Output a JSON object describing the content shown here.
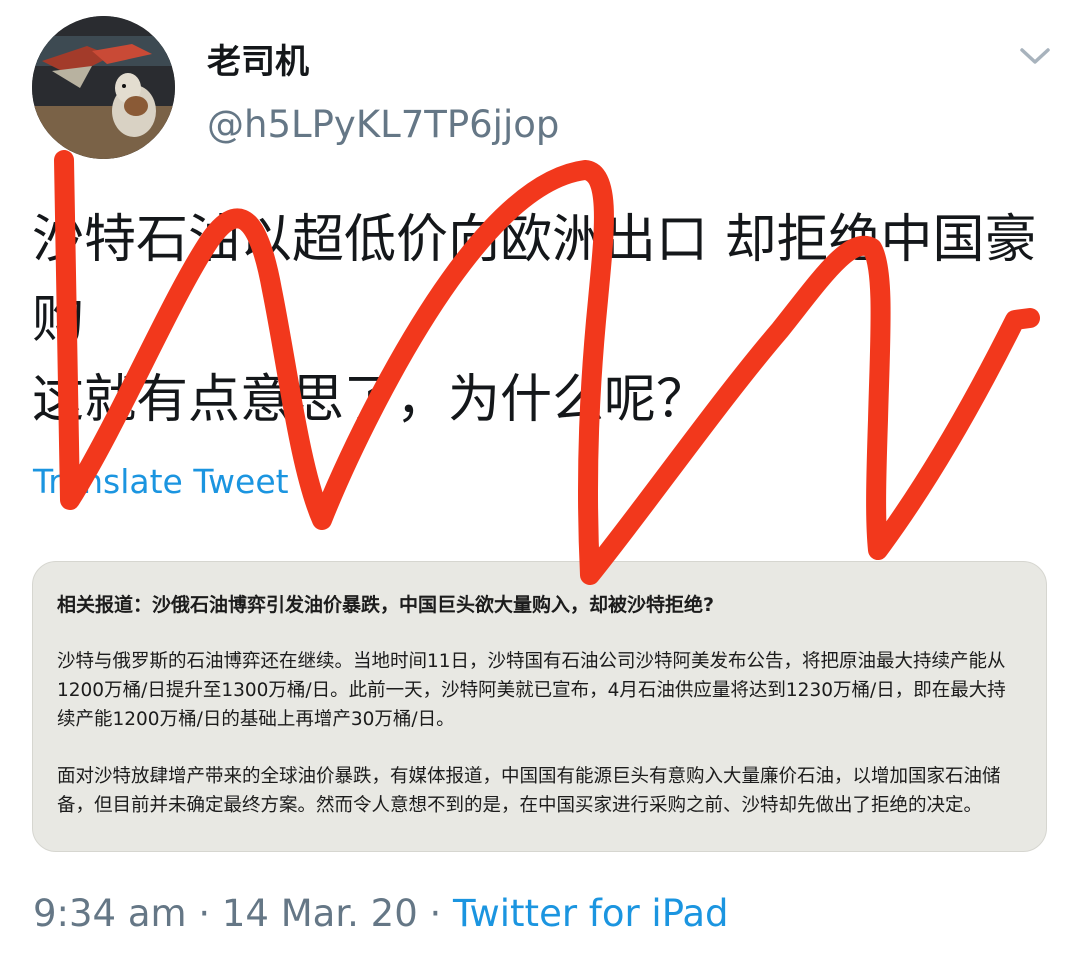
{
  "author": {
    "display_name": "老司机",
    "handle": "@h5LPyKL7TP6jjop"
  },
  "tweet": {
    "text": "沙特石油以超低价向欧洲出口 却拒绝中国豪购\n这就有点意思了，为什么呢？",
    "translate_label": "Translate Tweet"
  },
  "card": {
    "title": "相关报道：沙俄石油博弈引发油价暴跌，中国巨头欲大量购入，却被沙特拒绝?",
    "paragraphs": [
      "沙特与俄罗斯的石油博弈还在继续。当地时间11日，沙特国有石油公司沙特阿美发布公告，将把原油最大持续产能从1200万桶/日提升至1300万桶/日。此前一天，沙特阿美就已宣布，4月石油供应量将达到1230万桶/日，即在最大持续产能1200万桶/日的基础上再增产30万桶/日。",
      "面对沙特放肆增产带来的全球油价暴跌，有媒体报道，中国国有能源巨头有意购入大量廉价石油，以增加国家石油储备，但目前并未确定最终方案。然而令人意想不到的是，在中国买家进行采购之前、沙特却先做出了拒绝的决定。"
    ]
  },
  "meta": {
    "time": "9:34 am",
    "separator": " · ",
    "date": "14 Mar. 20",
    "source": "Twitter for iPad"
  },
  "colors": {
    "link": "#1b95e0",
    "secondary_text": "#657786",
    "scribble": "#f2381c",
    "card_bg": "#e8e8e3"
  },
  "icons": {
    "menu": "chevron-down-icon"
  }
}
